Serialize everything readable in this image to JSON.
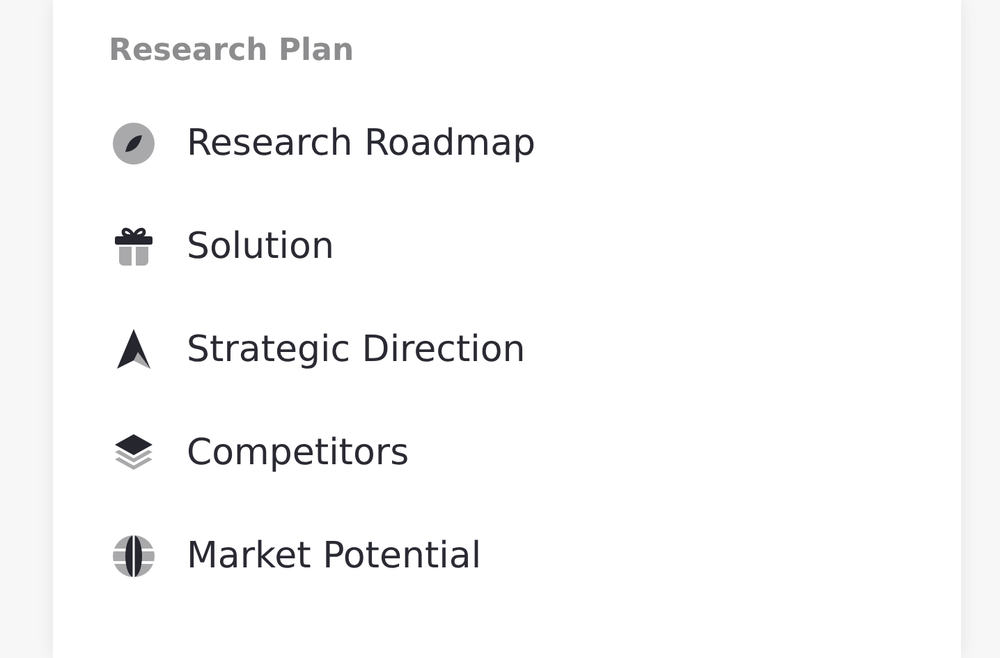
{
  "section": {
    "title": "Research Plan"
  },
  "items": [
    {
      "label": "Research Roadmap",
      "kind": "compass"
    },
    {
      "label": "Solution",
      "kind": "gift"
    },
    {
      "label": "Strategic Direction",
      "kind": "navigation"
    },
    {
      "label": "Competitors",
      "kind": "layers"
    },
    {
      "label": "Market Potential",
      "kind": "globe"
    }
  ]
}
